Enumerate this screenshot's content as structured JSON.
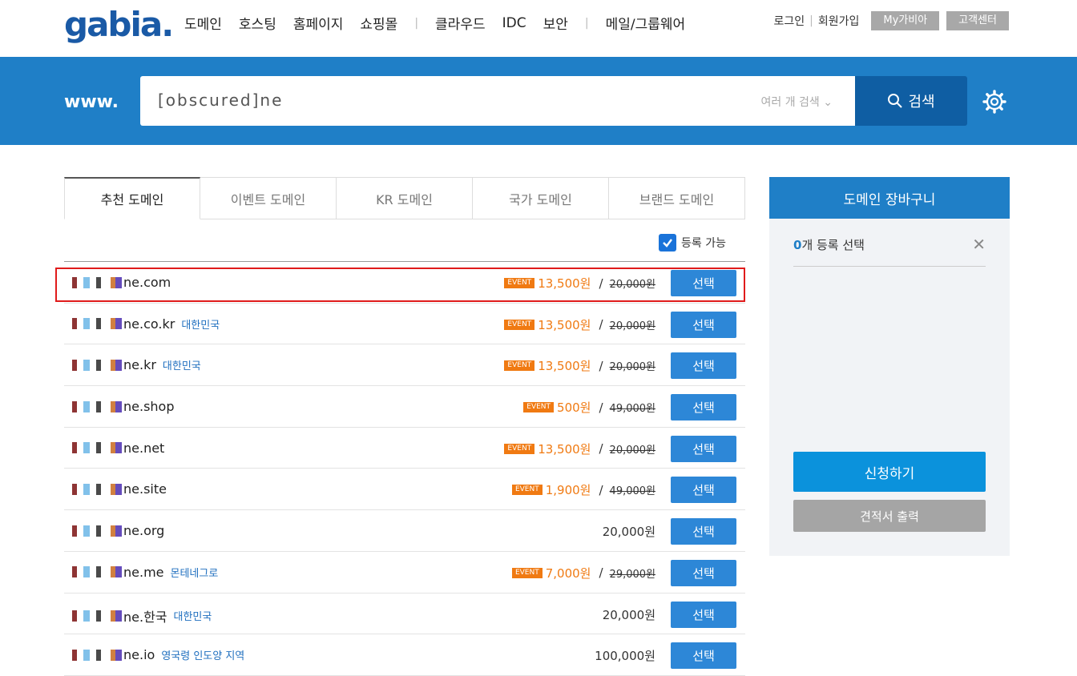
{
  "header": {
    "logo": "gabia.",
    "nav": [
      {
        "label": "도메인",
        "name": "nav-domain"
      },
      {
        "label": "호스팅",
        "name": "nav-hosting"
      },
      {
        "label": "홈페이지",
        "name": "nav-homepage"
      },
      {
        "label": "쇼핑몰",
        "name": "nav-shopping"
      },
      {
        "label": "클라우드",
        "name": "nav-cloud"
      },
      {
        "label": "IDC",
        "name": "nav-idc"
      },
      {
        "label": "보안",
        "name": "nav-security"
      },
      {
        "label": "메일/그룹웨어",
        "name": "nav-mail"
      }
    ],
    "login": "로그인",
    "signup": "회원가입",
    "mygabia": "My가비아",
    "support": "고객센터"
  },
  "search": {
    "prefix": "www.",
    "value": "[obscured]ne",
    "multi_label": "여러 개 검색",
    "button_label": "검색"
  },
  "tabs": [
    {
      "label": "추천 도메인",
      "active": true
    },
    {
      "label": "이벤트 도메인",
      "active": false
    },
    {
      "label": "KR 도메인",
      "active": false
    },
    {
      "label": "국가 도메인",
      "active": false
    },
    {
      "label": "브랜드 도메인",
      "active": false
    }
  ],
  "filter": {
    "available_label": "등록 가능",
    "checked": true
  },
  "event_badge": "EVENT",
  "select_label": "선택",
  "rows": [
    {
      "suffix": "ne.com",
      "country": "",
      "event": true,
      "sale": "13,500원",
      "orig": "20,000원"
    },
    {
      "suffix": "ne.co.kr",
      "country": "대한민국",
      "event": true,
      "sale": "13,500원",
      "orig": "20,000원"
    },
    {
      "suffix": "ne.kr",
      "country": "대한민국",
      "event": true,
      "sale": "13,500원",
      "orig": "20,000원"
    },
    {
      "suffix": "ne.shop",
      "country": "",
      "event": true,
      "sale": "500원",
      "orig": "49,000원"
    },
    {
      "suffix": "ne.net",
      "country": "",
      "event": true,
      "sale": "13,500원",
      "orig": "20,000원"
    },
    {
      "suffix": "ne.site",
      "country": "",
      "event": true,
      "sale": "1,900원",
      "orig": "49,000원"
    },
    {
      "suffix": "ne.org",
      "country": "",
      "event": false,
      "price": "20,000원"
    },
    {
      "suffix": "ne.me",
      "country": "몬테네그로",
      "event": true,
      "sale": "7,000원",
      "orig": "29,000원"
    },
    {
      "suffix": "ne.한국",
      "country": "대한민국",
      "event": false,
      "price": "20,000원"
    },
    {
      "suffix": "ne.io",
      "country": "영국령 인도양 지역",
      "event": false,
      "price": "100,000원"
    }
  ],
  "cart": {
    "title": "도메인 장바구니",
    "count": "0",
    "count_label": "개 등록 선택",
    "apply_label": "신청하기",
    "quote_label": "견적서 출력"
  },
  "colors": {
    "primary": "#1f7fc7",
    "event": "#f07a12",
    "highlight": "#e01b1b"
  }
}
